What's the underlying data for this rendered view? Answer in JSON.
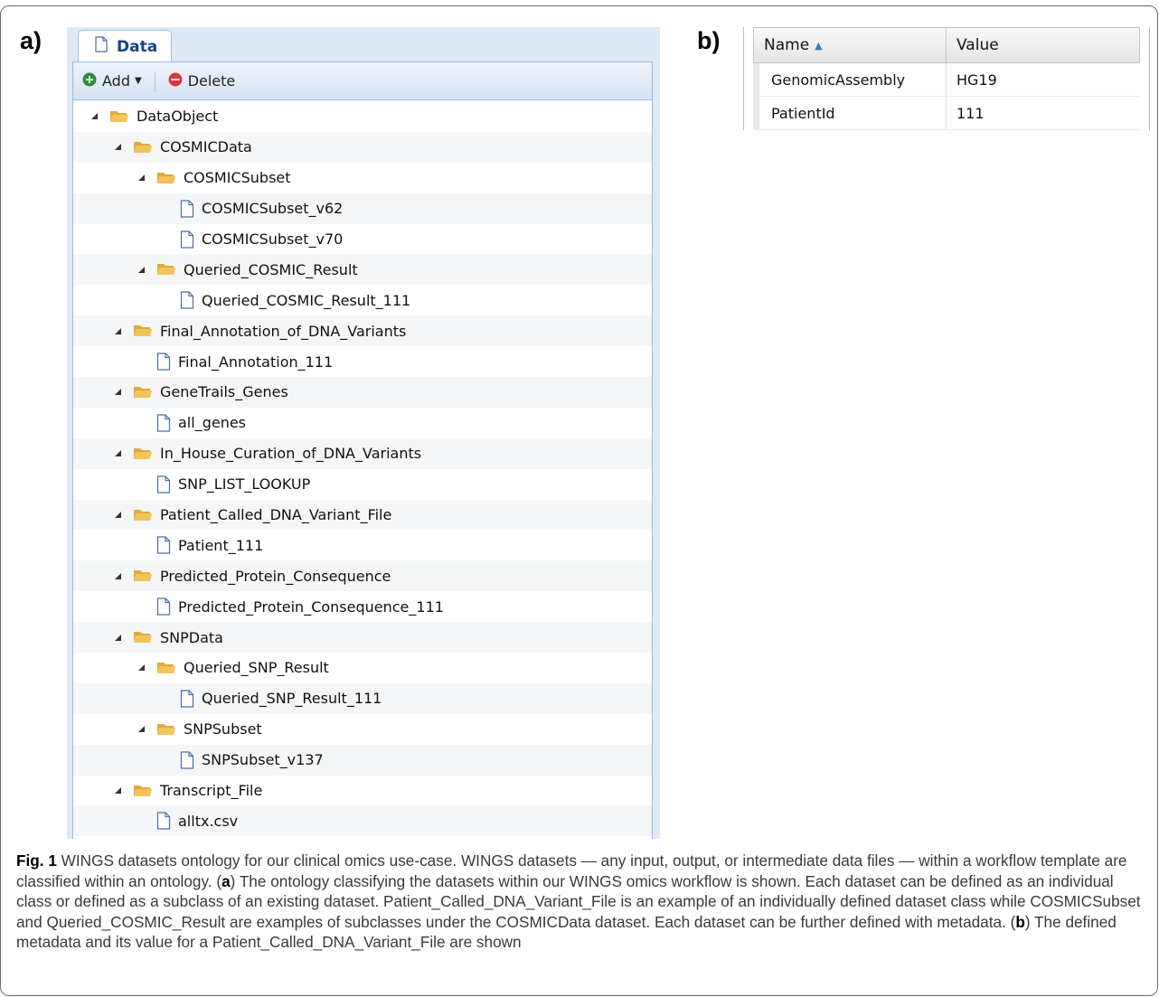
{
  "labels": {
    "panel_a": "a)",
    "panel_b": "b)"
  },
  "panel_a": {
    "tab_label": "Data",
    "toolbar": {
      "add_label": "Add",
      "delete_label": "Delete"
    },
    "tree": [
      {
        "label": "DataObject",
        "type": "folder",
        "depth": 0
      },
      {
        "label": "COSMICData",
        "type": "folder",
        "depth": 1
      },
      {
        "label": "COSMICSubset",
        "type": "folder",
        "depth": 2
      },
      {
        "label": "COSMICSubset_v62",
        "type": "file",
        "depth": 3
      },
      {
        "label": "COSMICSubset_v70",
        "type": "file",
        "depth": 3
      },
      {
        "label": "Queried_COSMIC_Result",
        "type": "folder",
        "depth": 2
      },
      {
        "label": "Queried_COSMIC_Result_111",
        "type": "file",
        "depth": 3
      },
      {
        "label": "Final_Annotation_of_DNA_Variants",
        "type": "folder",
        "depth": 1
      },
      {
        "label": "Final_Annotation_111",
        "type": "file",
        "depth": 2
      },
      {
        "label": "GeneTrails_Genes",
        "type": "folder",
        "depth": 1
      },
      {
        "label": "all_genes",
        "type": "file",
        "depth": 2
      },
      {
        "label": "In_House_Curation_of_DNA_Variants",
        "type": "folder",
        "depth": 1
      },
      {
        "label": "SNP_LIST_LOOKUP",
        "type": "file",
        "depth": 2
      },
      {
        "label": "Patient_Called_DNA_Variant_File",
        "type": "folder",
        "depth": 1
      },
      {
        "label": "Patient_111",
        "type": "file",
        "depth": 2
      },
      {
        "label": "Predicted_Protein_Consequence",
        "type": "folder",
        "depth": 1
      },
      {
        "label": "Predicted_Protein_Consequence_111",
        "type": "file",
        "depth": 2
      },
      {
        "label": "SNPData",
        "type": "folder",
        "depth": 1
      },
      {
        "label": "Queried_SNP_Result",
        "type": "folder",
        "depth": 2
      },
      {
        "label": "Queried_SNP_Result_111",
        "type": "file",
        "depth": 3
      },
      {
        "label": "SNPSubset",
        "type": "folder",
        "depth": 2
      },
      {
        "label": "SNPSubset_v137",
        "type": "file",
        "depth": 3
      },
      {
        "label": "Transcript_File",
        "type": "folder",
        "depth": 1
      },
      {
        "label": "alltx.csv",
        "type": "file",
        "depth": 2
      }
    ]
  },
  "panel_b": {
    "columns": {
      "name": "Name",
      "value": "Value"
    },
    "rows": [
      {
        "name": "GenomicAssembly",
        "value": "HG19"
      },
      {
        "name": "PatientId",
        "value": "111"
      }
    ]
  },
  "caption": {
    "fig_label": "Fig. 1",
    "text_1": " WINGS datasets ontology for our clinical omics use-case. WINGS datasets — any input, output, or intermediate data files — within a workflow template are classified within an ontology. (",
    "a_letter": "a",
    "text_2": ") The ontology classifying the datasets within our WINGS omics workflow is shown. Each dataset can be defined as an individual class or defined as a subclass of an existing dataset. Patient_Called_DNA_Variant_File is an example of an individually defined dataset class while COSMICSubset and Queried_COSMIC_Result are examples of subclasses under the COSMICData dataset. Each dataset can be further defined with metadata. (",
    "b_letter": "b",
    "text_3": ") The defined metadata and its value for a Patient_Called_DNA_Variant_File are shown"
  },
  "colors": {
    "folder": "#f2c45a",
    "panel_bg": "#dfe9f5",
    "border": "#99bbe8",
    "tab_text": "#15428b",
    "add_icon": "#2e8b3c",
    "delete_icon": "#d9363e"
  }
}
